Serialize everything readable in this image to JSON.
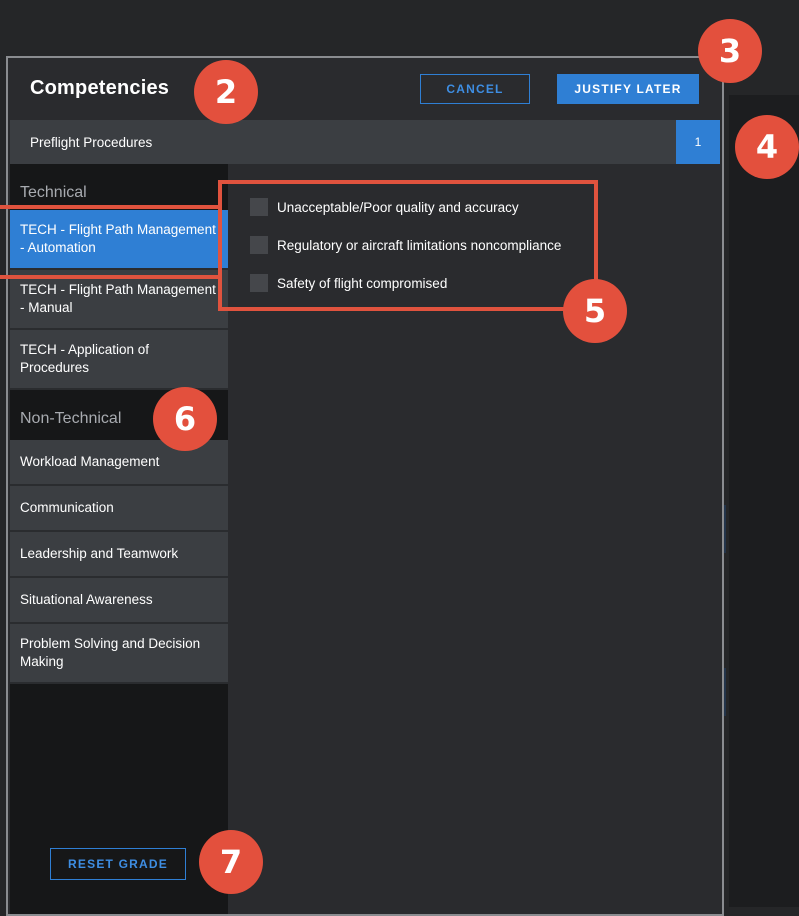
{
  "modal": {
    "title": "Competencies",
    "cancel_label": "CANCEL",
    "justify_later_label": "JUSTIFY LATER",
    "reset_label": "RESET GRADE"
  },
  "phase": {
    "name": "Preflight Procedures",
    "count": "1"
  },
  "technical": {
    "heading": "Technical",
    "items": [
      {
        "label": "TECH - Flight Path Management - Automation",
        "selected": true
      },
      {
        "label": "TECH - Flight Path Management - Manual",
        "selected": false
      },
      {
        "label": "TECH - Application of Procedures",
        "selected": false
      }
    ]
  },
  "non_technical": {
    "heading": "Non-Technical",
    "items": [
      {
        "label": "Workload Management"
      },
      {
        "label": "Communication"
      },
      {
        "label": "Leadership and Teamwork"
      },
      {
        "label": "Situational Awareness"
      },
      {
        "label": "Problem Solving and Decision Making"
      }
    ]
  },
  "observations": [
    {
      "label": "Unacceptable/Poor quality and accuracy",
      "checked": false
    },
    {
      "label": "Regulatory or aircraft limitations noncompliance",
      "checked": false
    },
    {
      "label": "Safety of flight compromised",
      "checked": false
    }
  ],
  "callouts": [
    "2",
    "3",
    "4",
    "5",
    "6",
    "7"
  ],
  "colors": {
    "accent": "#2f7fd4",
    "callout": "#e3503d",
    "panel": "#3b3e42",
    "background": "#252628"
  }
}
